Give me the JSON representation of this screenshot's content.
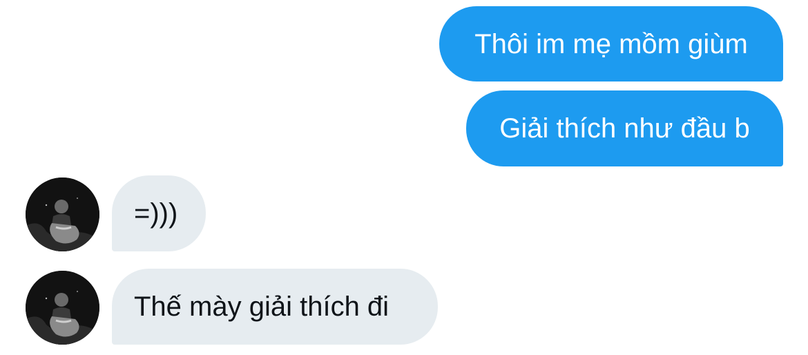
{
  "conversation": {
    "messages": [
      {
        "sender": "self",
        "text": "Thôi im mẹ mồm giùm"
      },
      {
        "sender": "self",
        "text": "Giải thích như đầu b"
      },
      {
        "sender": "other",
        "text": "=)))"
      },
      {
        "sender": "other",
        "text": "Thế mày giải thích đi"
      }
    ]
  },
  "colors": {
    "outgoing_bubble": "#1d9bf0",
    "outgoing_text": "#ffffff",
    "incoming_bubble": "#e6ecf0",
    "incoming_text": "#0f1419",
    "background": "#ffffff"
  },
  "icons": {
    "avatar": "contact-avatar-photo"
  }
}
